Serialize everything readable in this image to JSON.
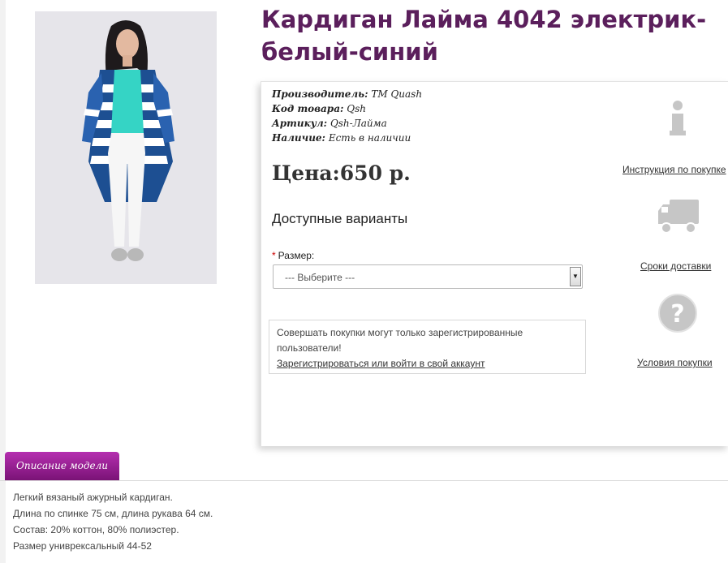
{
  "product": {
    "title": "Кардиган Лайма 4042 электрик-белый-синий",
    "meta": [
      {
        "label": "Производитель:",
        "value": "ТМ Quash"
      },
      {
        "label": "Код товара:",
        "value": "Qsh"
      },
      {
        "label": "Артикул:",
        "value": "Qsh-Лайма"
      },
      {
        "label": "Наличие:",
        "value": "Есть в наличии"
      }
    ],
    "price": "Цена:650 р."
  },
  "options": {
    "title": "Доступные варианты",
    "required_mark": "*",
    "size_label": "Размер:",
    "size_placeholder": "--- Выберите ---"
  },
  "login_notice": {
    "text": "Совершать покупки могут только зарегистрированные пользователи!",
    "link": "Зарегистрироваться или войти в свой аккаунт"
  },
  "side_links": [
    {
      "label": "Инструкция по покупке",
      "icon": "info-icon"
    },
    {
      "label": "Сроки доставки",
      "icon": "truck-icon"
    },
    {
      "label": "Условия покупки",
      "icon": "question-icon"
    }
  ],
  "tabs": [
    {
      "label": "Описание модели"
    }
  ],
  "description": [
    "Легкий вязаный ажурный кардиган.",
    "Длина по спинке 75 см, длина рукава 64 см.",
    "Состав: 20% коттон, 80% полиэстер.",
    "Размер униврексальный 44-52"
  ],
  "colors": {
    "title": "#5b1f5c",
    "tab_top": "#b52fb0",
    "tab_bottom": "#7a1376",
    "icon_gray": "#c8c8c8"
  }
}
